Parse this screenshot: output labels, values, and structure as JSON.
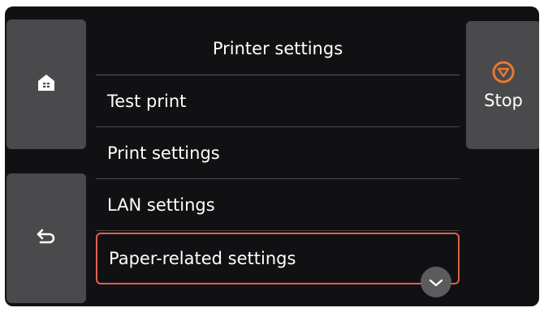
{
  "header": {
    "title": "Printer settings"
  },
  "side_buttons": {
    "home_icon": "home-icon",
    "back_icon": "back-arrow-icon",
    "stop_label": "Stop",
    "stop_icon": "stop-icon",
    "stop_color": "#e8782e"
  },
  "menu": {
    "items": [
      {
        "label": "Test print"
      },
      {
        "label": "Print settings"
      },
      {
        "label": "LAN settings"
      },
      {
        "label": "Paper-related settings"
      }
    ],
    "selected_border_color": "#e0614a",
    "scroll_icon": "chevron-down-icon"
  }
}
